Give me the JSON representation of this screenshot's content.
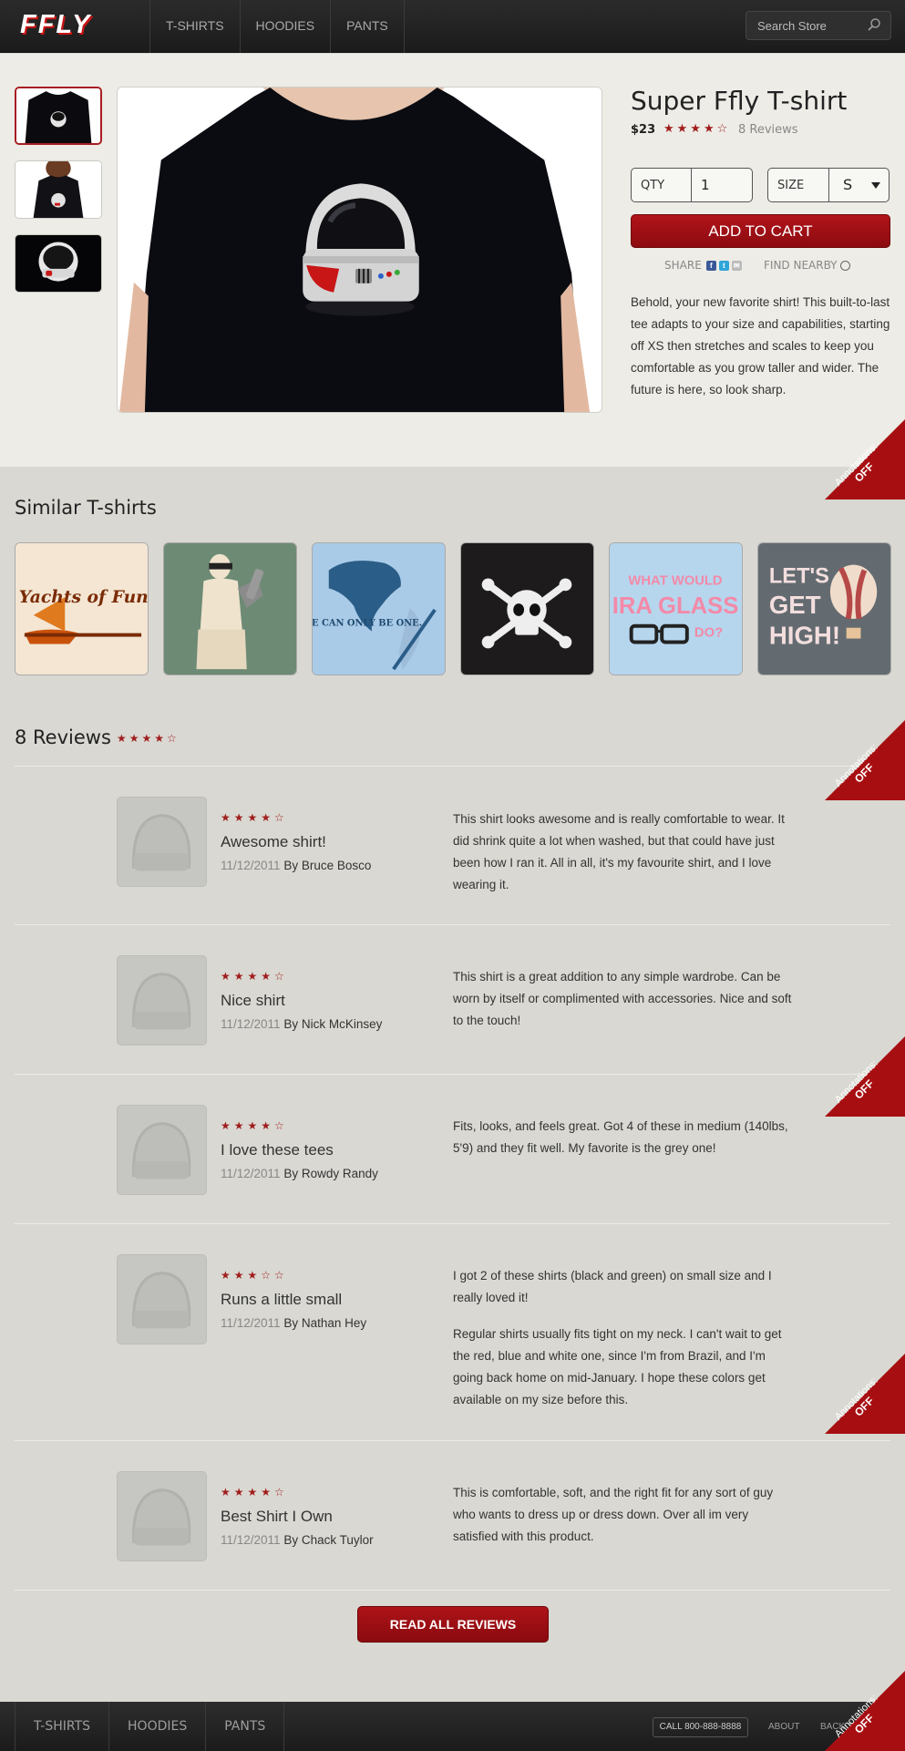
{
  "header": {
    "logo": "FFLY",
    "nav": [
      "T-SHIRTS",
      "HOODIES",
      "PANTS"
    ],
    "search_placeholder": "Search Store"
  },
  "product": {
    "title": "Super Ffly T-shirt",
    "price": "$23",
    "stars": "★★★★☆",
    "rating": 4,
    "reviews_link": "8 Reviews",
    "qty_label": "QTY",
    "qty_value": "1",
    "size_label": "SIZE",
    "size_value": "S",
    "add_to_cart": "ADD TO CART",
    "share_label": "SHARE",
    "find_nearby": "FIND NEARBY",
    "description": "Behold, your new favorite shirt! This built-to-last tee adapts to your size and capabilities, starting off XS then stretches and scales to keep you comfortable as you grow taller and wider. The future is here, so look sharp."
  },
  "annotations": {
    "label": "Annotations:",
    "state": "OFF"
  },
  "similar": {
    "title": "Similar T-shirts",
    "items": [
      {
        "text": "Yachts of Fun!"
      },
      {
        "text": ""
      },
      {
        "text": "THERE CAN ONLY BE ONE."
      },
      {
        "text": ""
      },
      {
        "text": "WHAT WOULD IRA GLASS DO?"
      },
      {
        "text": "LET'S GET HIGH!"
      }
    ]
  },
  "reviews": {
    "title": "8 Reviews",
    "title_stars": "★★★★☆",
    "items": [
      {
        "stars": "★★★★☆",
        "rating": 4,
        "title": "Awesome shirt!",
        "date": "11/12/2011",
        "by": "By Bruce Bosco",
        "text": [
          "This shirt looks awesome and is really comfortable to wear. It did shrink quite a lot when washed, but that could have just been how I ran it. All in all, it's my favourite shirt, and I love wearing it."
        ]
      },
      {
        "stars": "★★★★☆",
        "rating": 4,
        "title": "Nice shirt",
        "date": "11/12/2011",
        "by": "By Nick McKinsey",
        "text": [
          "This shirt is a great addition to any simple wardrobe. Can be worn by itself or complimented with accessories. Nice and soft to the touch!"
        ]
      },
      {
        "stars": "★★★★☆",
        "rating": 4,
        "title": "I love these tees",
        "date": "11/12/2011",
        "by": "By Rowdy Randy",
        "text": [
          "Fits, looks, and feels great. Got 4 of these in medium (140lbs, 5'9) and they fit well. My favorite is the grey one!"
        ]
      },
      {
        "stars": "★★★☆☆",
        "rating": 3,
        "title": "Runs a little small",
        "date": "11/12/2011",
        "by": "By Nathan Hey",
        "text": [
          "I got 2 of these shirts (black and green) on small size and I really loved it!",
          "Regular shirts usually fits tight on my neck. I can't wait to get the red, blue and white one, since I'm from Brazil, and I'm going back home on mid-January. I hope these colors get available on my size before this."
        ]
      },
      {
        "stars": "★★★★☆",
        "rating": 4,
        "title": "Best Shirt I Own",
        "date": "11/12/2011",
        "by": "By Chack Tuylor",
        "text": [
          "This is comfortable, soft, and the right fit for any sort of guy who wants to dress up or dress down. Over all im very satisfied with this product."
        ]
      }
    ],
    "read_all": "READ ALL REVIEWS"
  },
  "footer": {
    "nav": [
      "T-SHIRTS",
      "HOODIES",
      "PANTS"
    ],
    "call": "CALL 800-888-8888",
    "about": "ABOUT",
    "back_to_top": "BACK TO TOP"
  },
  "colors": {
    "accent": "#a70e12",
    "star": "#a01d1d"
  }
}
